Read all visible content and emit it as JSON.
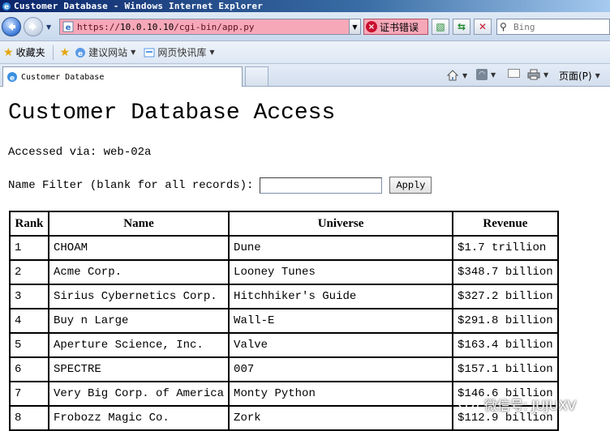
{
  "window": {
    "title": "Customer Database - Windows Internet Explorer"
  },
  "navbar": {
    "url_prefix": "https://",
    "url_host": "10.0.10.10",
    "url_path": "/cgi-bin/app.py",
    "cert_error_label": "证书错误",
    "search_placeholder": "Bing"
  },
  "favorites": {
    "favorites_label": "收藏夹",
    "links": [
      {
        "label": "建议网站"
      },
      {
        "label": "网页快讯库"
      }
    ]
  },
  "tabs": {
    "active_tab_label": "Customer Database",
    "page_menu_label": "页面(P)"
  },
  "page": {
    "title": "Customer Database Access",
    "accessed_via": "Accessed via: web-02a",
    "filter_label": "Name Filter (blank for all records):",
    "filter_value": "",
    "apply_label": "Apply",
    "table": {
      "headers": [
        "Rank",
        "Name",
        "Universe",
        "Revenue"
      ],
      "rows": [
        [
          "1",
          "CHOAM",
          "Dune",
          "$1.7 trillion"
        ],
        [
          "2",
          "Acme Corp.",
          "Looney Tunes",
          "$348.7 billion"
        ],
        [
          "3",
          "Sirius Cybernetics Corp.",
          "Hitchhiker's Guide",
          "$327.2 billion"
        ],
        [
          "4",
          "Buy n Large",
          "Wall-E",
          "$291.8 billion"
        ],
        [
          "5",
          "Aperture Science, Inc.",
          "Valve",
          "$163.4 billion"
        ],
        [
          "6",
          "SPECTRE",
          "007",
          "$157.1 billion"
        ],
        [
          "7",
          "Very Big Corp. of America",
          "Monty Python",
          "$146.6 billion"
        ],
        [
          "8",
          "Frobozz Magic Co.",
          "Zork",
          "$112.9 billion"
        ]
      ]
    }
  },
  "watermark": {
    "text": "微信号: JUJUXV"
  },
  "colors": {
    "titlebar": "#0a246a",
    "address_error_bg": "#f7a8b8",
    "cert_error_icon": "#c8102e"
  }
}
